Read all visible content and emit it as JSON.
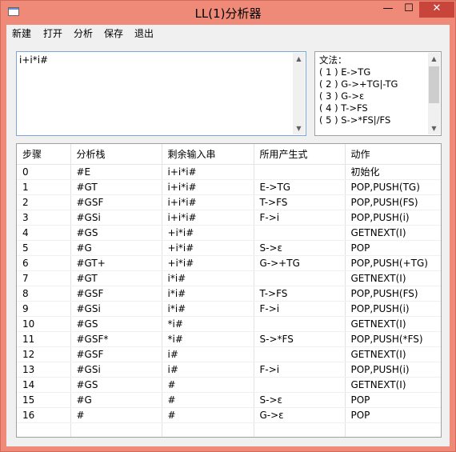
{
  "window": {
    "title": "LL(1)分析器",
    "minimize_glyph": "—",
    "maximize_glyph": "☐",
    "close_glyph": "✕",
    "accent": "#f08a78",
    "close_color": "#c7453a"
  },
  "menu": {
    "items": [
      {
        "label": "新建"
      },
      {
        "label": "打开"
      },
      {
        "label": "分析"
      },
      {
        "label": "保存"
      },
      {
        "label": "退出"
      }
    ]
  },
  "input": {
    "value": "i+i*i#"
  },
  "grammar": {
    "title": "文法：",
    "rules": [
      "( 1 ) E->TG",
      "( 2 ) G->+TG|-TG",
      "( 3 ) G->ε",
      "( 4 ) T->FS",
      "( 5 ) S->*FS|/FS"
    ]
  },
  "table": {
    "headers": [
      "步骤",
      "分析栈",
      "剩余输入串",
      "所用产生式",
      "动作"
    ],
    "rows": [
      [
        "0",
        "#E",
        "i+i*i#",
        "",
        "初始化"
      ],
      [
        "1",
        "#GT",
        "i+i*i#",
        "E->TG",
        "POP,PUSH(TG)"
      ],
      [
        "2",
        "#GSF",
        "i+i*i#",
        "T->FS",
        "POP,PUSH(FS)"
      ],
      [
        "3",
        "#GSi",
        "i+i*i#",
        "F->i",
        "POP,PUSH(i)"
      ],
      [
        "4",
        "#GS",
        "+i*i#",
        "",
        "GETNEXT(I)"
      ],
      [
        "5",
        "#G",
        "+i*i#",
        "S->ε",
        "POP"
      ],
      [
        "6",
        "#GT+",
        "+i*i#",
        "G->+TG",
        "POP,PUSH(+TG)"
      ],
      [
        "7",
        "#GT",
        "i*i#",
        "",
        "GETNEXT(I)"
      ],
      [
        "8",
        "#GSF",
        "i*i#",
        "T->FS",
        "POP,PUSH(FS)"
      ],
      [
        "9",
        "#GSi",
        "i*i#",
        "F->i",
        "POP,PUSH(i)"
      ],
      [
        "10",
        "#GS",
        "*i#",
        "",
        "GETNEXT(I)"
      ],
      [
        "11",
        "#GSF*",
        "*i#",
        "S->*FS",
        "POP,PUSH(*FS)"
      ],
      [
        "12",
        "#GSF",
        "i#",
        "",
        "GETNEXT(I)"
      ],
      [
        "13",
        "#GSi",
        "i#",
        "F->i",
        "POP,PUSH(i)"
      ],
      [
        "14",
        "#GS",
        "#",
        "",
        "GETNEXT(I)"
      ],
      [
        "15",
        "#G",
        "#",
        "S->ε",
        "POP"
      ],
      [
        "16",
        "#",
        "#",
        "G->ε",
        "POP"
      ]
    ]
  }
}
